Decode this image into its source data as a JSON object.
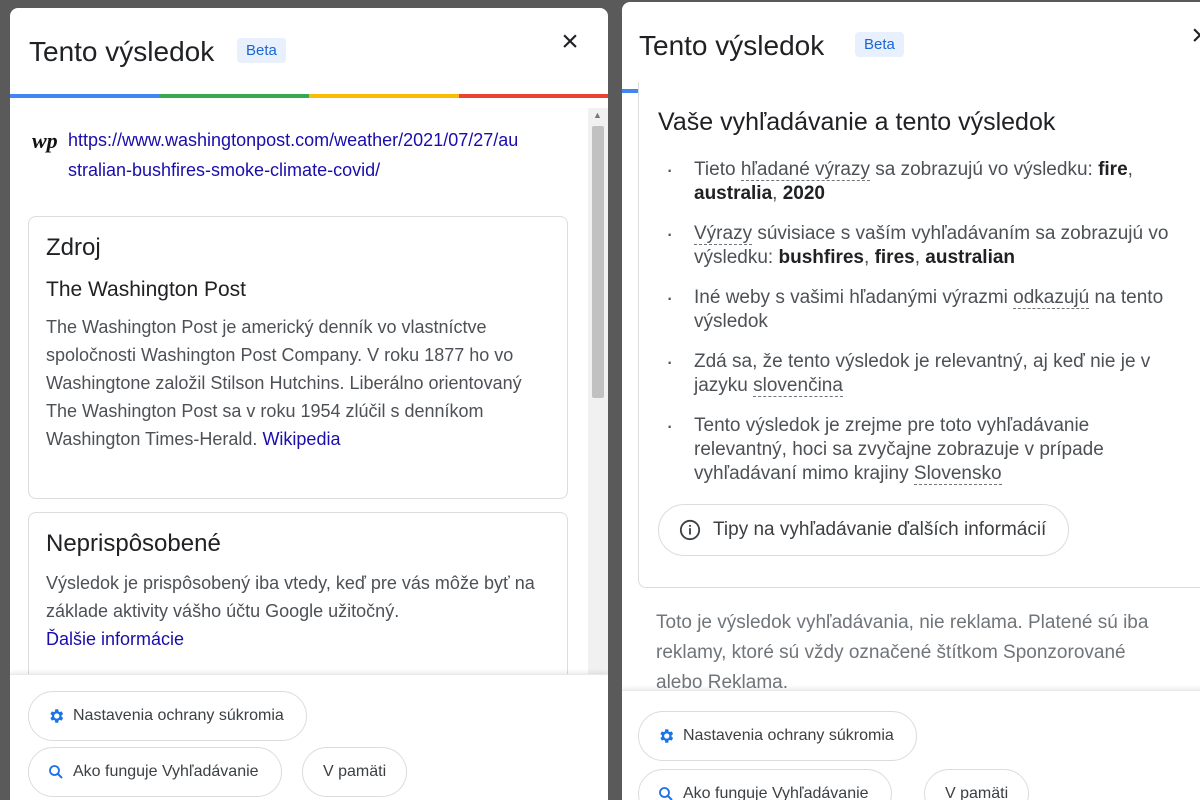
{
  "left": {
    "title": "Tento výsledok",
    "beta": "Beta",
    "close": "×",
    "source_logo": "wp",
    "url": "https://www.washingtonpost.com/weather/2021/07/27/australian-bushfires-smoke-climate-covid/",
    "url_line1": "https://www.washingtonpost.com/weather/2021/07/27/au",
    "url_line2": "stralian-bushfires-smoke-climate-covid/",
    "source_card": {
      "heading": "Zdroj",
      "name": "The Washington Post",
      "description": "The Washington Post je americký denník vo vlastníctve spoločnosti Washington Post Company. V roku 1877 ho vo Washingtone založil Stilson Hutchins. Liberálno orientovaný The Washington Post sa v roku 1954 zlúčil s denníkom Washington Times-Herald.",
      "wiki_link": "Wikipedia"
    },
    "personal_card": {
      "heading": "Neprispôsobené",
      "description": "Výsledok je prispôsobený iba vtedy, keď pre vás môže byť na základe aktivity vášho účtu Google užitočný.",
      "more_link": "Ďalšie informácie"
    },
    "footer": {
      "privacy": "Nastavenia ochrany súkromia",
      "how_search": "Ako funguje Vyhľadávanie",
      "cache": "V pamäti"
    }
  },
  "right": {
    "title": "Tento výsledok",
    "beta": "Beta",
    "close": "×",
    "section_title": "Vaše vyhľadávanie a tento výsledok",
    "r1": {
      "a": "Tieto ",
      "b": "hľadané výrazy",
      "c": " sa zobrazujú vo výsledku: ",
      "t1": "fire",
      "sep1": ", ",
      "t2": "australia",
      "sep2": ", ",
      "t3": "2020"
    },
    "r2": {
      "a": "Výrazy",
      "b": " súvisiace s vaším vyhľadávaním sa zobrazujú vo výsledku: ",
      "t1": "bushfires",
      "sep1": ", ",
      "t2": "fires",
      "sep2": ", ",
      "t3": "australian"
    },
    "r3": {
      "a": "Iné weby s vašimi hľadanými výrazmi ",
      "b": "odkazujú",
      "c": " na tento výsledok"
    },
    "r4": {
      "a": "Zdá sa, že tento výsledok je relevantný, aj keď nie je v jazyku ",
      "b": "slovenčina"
    },
    "r5": {
      "a": "Tento výsledok je zrejme pre toto vyhľadávanie relevantný, hoci sa zvyčajne zobrazuje v prípade vyhľadávaní mimo krajiny ",
      "b": "Slovensko"
    },
    "tips": "Tipy na vyhľadávanie ďalších informácií",
    "ad_note": "Toto je výsledok vyhľadávania, nie reklama. Platené sú iba reklamy, ktoré sú vždy označené štítkom Sponzorované alebo Reklama.",
    "footer": {
      "privacy": "Nastavenia ochrany súkromia",
      "how_search": "Ako funguje Vyhľadávanie",
      "cache": "V pamäti"
    }
  },
  "colors": {
    "blue": "#4285f4",
    "green": "#34a853",
    "yellow": "#fbbc04",
    "red": "#ea4335",
    "link": "#1a0dab"
  }
}
